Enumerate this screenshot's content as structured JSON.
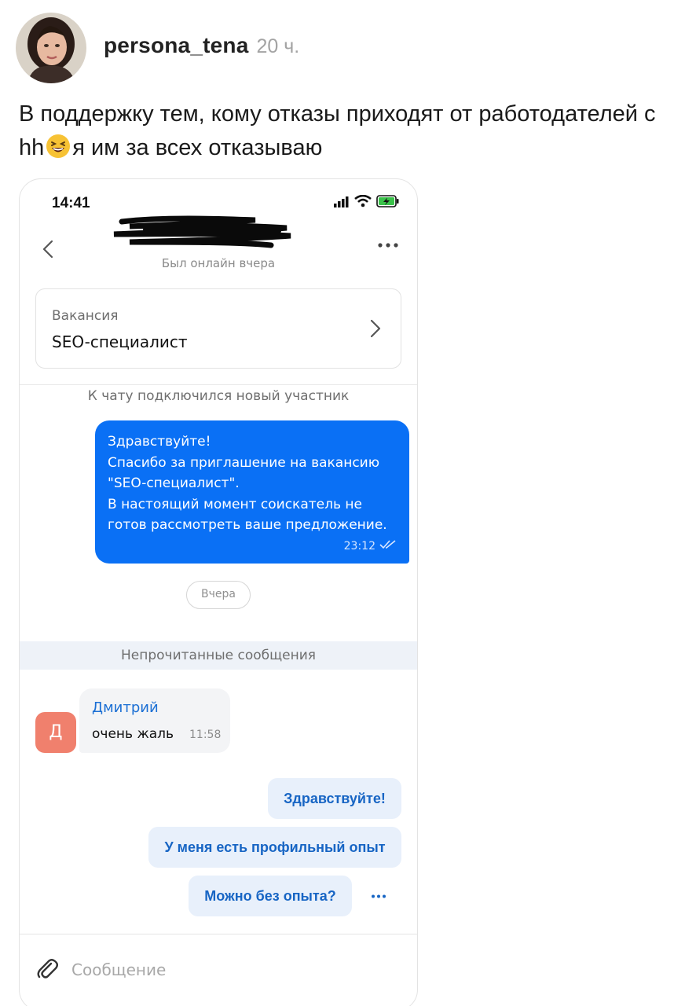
{
  "post": {
    "author": "persona_tena",
    "time": "20 ч.",
    "text_before_emoji": "В поддержку тем, кому отказы приходят от работодателей с hh",
    "emoji": "laughing-face-emoji",
    "text_after_emoji": "я им за всех отказываю"
  },
  "phone": {
    "status": {
      "time": "14:41",
      "icons": [
        "signal-icon",
        "wifi-icon",
        "battery-charging-icon"
      ]
    },
    "chat": {
      "presence": "Был онлайн вчера",
      "name_redacted": true
    },
    "vacancy": {
      "label": "Вакансия",
      "title": "SEO-специалист"
    },
    "system_message": "К чату подключился новый участник",
    "outgoing": {
      "lines": [
        "Здравствуйте!",
        "Спасибо за приглашение на вакансию",
        "\"SEO-специалист\".",
        "В настоящий момент соискатель не",
        "готов рассмотреть ваше предложение."
      ],
      "time": "23:12",
      "status": "read"
    },
    "day_separator": "Вчера",
    "unread_label": "Непрочитанные сообщения",
    "incoming": {
      "avatar_letter": "Д",
      "sender": "Дмитрий",
      "text": "очень жаль",
      "time": "11:58"
    },
    "quick_replies": [
      "Здравствуйте!",
      "У меня есть профильный опыт",
      "Можно без опыта?"
    ],
    "composer": {
      "placeholder": "Сообщение"
    },
    "colors": {
      "outgoing_bubble": "#0a70f5",
      "quick_reply_bg": "#e8f0fb",
      "quick_reply_text": "#1765c4",
      "avatar_bg": "#f0806d",
      "unread_bar": "#eef2f8"
    }
  }
}
